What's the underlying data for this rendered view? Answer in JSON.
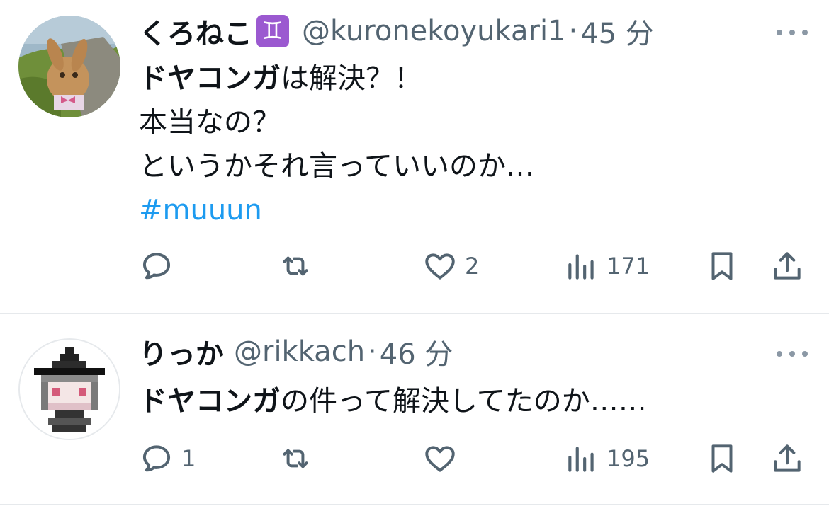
{
  "tweets": [
    {
      "display_name": "くろねこ",
      "zodiac_icon": "gemini-emoji-icon",
      "zodiac_glyph": "♊",
      "handle": "@kuronekoyukari1",
      "separator": "·",
      "time": "45 分",
      "body": {
        "line1_bold": "ドヤコンガ",
        "line1_rest": "は解決？！",
        "line2": "本当なの？",
        "line3": "というかそれ言っていいのか…",
        "hashtag": "#muuun"
      },
      "actions": {
        "reply_count": "",
        "retweet_count": "",
        "like_count": "2",
        "views_count": "171"
      }
    },
    {
      "display_name": "りっか",
      "handle": "@rikkach",
      "separator": "·",
      "time": "46 分",
      "body": {
        "line1_bold": "ドヤコンガ",
        "line1_rest": "の件って解決してたのか……"
      },
      "actions": {
        "reply_count": "1",
        "retweet_count": "",
        "like_count": "",
        "views_count": "195"
      }
    }
  ],
  "colors": {
    "text": "#0f1419",
    "secondary": "#536471",
    "link": "#1d9bf0",
    "divider": "#e6e9ec"
  }
}
